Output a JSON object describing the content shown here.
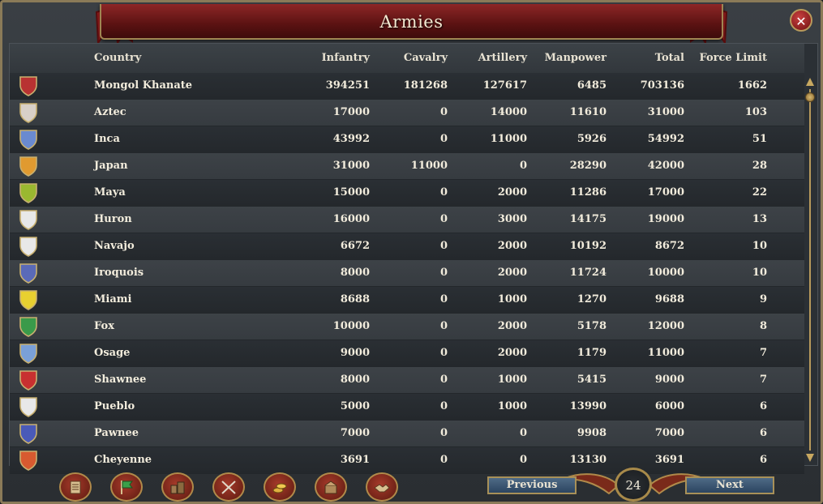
{
  "window": {
    "title": "Armies"
  },
  "header": {
    "country": "Country",
    "infantry": "Infantry",
    "cavalry": "Cavalry",
    "artillery": "Artillery",
    "manpower": "Manpower",
    "total": "Total",
    "force_limit": "Force Limit"
  },
  "rows": [
    {
      "country": "Mongol Khanate",
      "infantry": "394251",
      "cavalry": "181268",
      "artillery": "127617",
      "manpower": "6485",
      "total": "703136",
      "force_limit": "1662",
      "flag_color": "#b83232"
    },
    {
      "country": "Aztec",
      "infantry": "17000",
      "cavalry": "0",
      "artillery": "14000",
      "manpower": "11610",
      "total": "31000",
      "force_limit": "103",
      "flag_color": "#d8d0c8"
    },
    {
      "country": "Inca",
      "infantry": "43992",
      "cavalry": "0",
      "artillery": "11000",
      "manpower": "5926",
      "total": "54992",
      "force_limit": "51",
      "flag_color": "#6a8ad0"
    },
    {
      "country": "Japan",
      "infantry": "31000",
      "cavalry": "11000",
      "artillery": "0",
      "manpower": "28290",
      "total": "42000",
      "force_limit": "28",
      "flag_color": "#e09a30"
    },
    {
      "country": "Maya",
      "infantry": "15000",
      "cavalry": "0",
      "artillery": "2000",
      "manpower": "11286",
      "total": "17000",
      "force_limit": "22",
      "flag_color": "#9ab830"
    },
    {
      "country": "Huron",
      "infantry": "16000",
      "cavalry": "0",
      "artillery": "3000",
      "manpower": "14175",
      "total": "19000",
      "force_limit": "13",
      "flag_color": "#e8e8e8"
    },
    {
      "country": "Navajo",
      "infantry": "6672",
      "cavalry": "0",
      "artillery": "2000",
      "manpower": "10192",
      "total": "8672",
      "force_limit": "10",
      "flag_color": "#e8e8e8"
    },
    {
      "country": "Iroquois",
      "infantry": "8000",
      "cavalry": "0",
      "artillery": "2000",
      "manpower": "11724",
      "total": "10000",
      "force_limit": "10",
      "flag_color": "#5a6ab8"
    },
    {
      "country": "Miami",
      "infantry": "8688",
      "cavalry": "0",
      "artillery": "1000",
      "manpower": "1270",
      "total": "9688",
      "force_limit": "9",
      "flag_color": "#e8d030"
    },
    {
      "country": "Fox",
      "infantry": "10000",
      "cavalry": "0",
      "artillery": "2000",
      "manpower": "5178",
      "total": "12000",
      "force_limit": "8",
      "flag_color": "#3a9a4a"
    },
    {
      "country": "Osage",
      "infantry": "9000",
      "cavalry": "0",
      "artillery": "2000",
      "manpower": "1179",
      "total": "11000",
      "force_limit": "7",
      "flag_color": "#7aa0d8"
    },
    {
      "country": "Shawnee",
      "infantry": "8000",
      "cavalry": "0",
      "artillery": "1000",
      "manpower": "5415",
      "total": "9000",
      "force_limit": "7",
      "flag_color": "#c83030"
    },
    {
      "country": "Pueblo",
      "infantry": "5000",
      "cavalry": "0",
      "artillery": "1000",
      "manpower": "13990",
      "total": "6000",
      "force_limit": "6",
      "flag_color": "#e8e8e8"
    },
    {
      "country": "Pawnee",
      "infantry": "7000",
      "cavalry": "0",
      "artillery": "0",
      "manpower": "9908",
      "total": "7000",
      "force_limit": "6",
      "flag_color": "#4a5ab8"
    },
    {
      "country": "Cheyenne",
      "infantry": "3691",
      "cavalry": "0",
      "artillery": "0",
      "manpower": "13130",
      "total": "3691",
      "force_limit": "6",
      "flag_color": "#d85a30"
    }
  ],
  "pagination": {
    "previous_label": "Previous",
    "next_label": "Next",
    "page": "24"
  },
  "toolbar": {
    "buttons": [
      {
        "icon": "scroll-ledger-icon"
      },
      {
        "icon": "green-flag-icon"
      },
      {
        "icon": "buildings-icon"
      },
      {
        "icon": "crossed-swords-icon"
      },
      {
        "icon": "coins-icon"
      },
      {
        "icon": "trade-goods-icon"
      },
      {
        "icon": "handshake-icon"
      }
    ]
  }
}
